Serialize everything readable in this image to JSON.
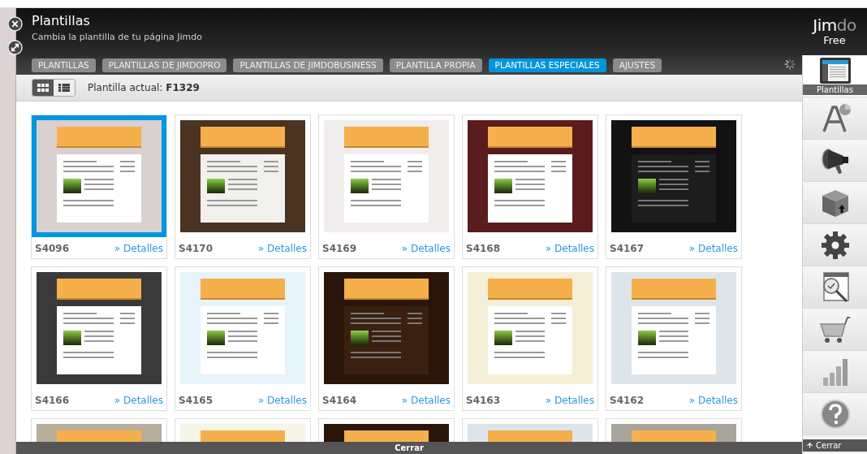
{
  "header": {
    "title": "Plantillas",
    "subtitle": "Cambia la plantilla de tu página Jimdo",
    "logo_parts": [
      "Jim",
      "do"
    ],
    "plan": "Free"
  },
  "tabs": [
    {
      "label": "PLANTILLAS",
      "selected": false
    },
    {
      "label": "PLANTILLAS DE JIMDOPRO",
      "selected": false
    },
    {
      "label": "PLANTILLAS DE JIMDOBUSINESS",
      "selected": false
    },
    {
      "label": "PLANTILLA PROPIA",
      "selected": false
    },
    {
      "label": "PLANTILLAS ESPECIALES",
      "selected": true
    },
    {
      "label": "AJUSTES",
      "selected": false
    }
  ],
  "toolbar": {
    "views": [
      {
        "kind": "grid",
        "selected": true
      },
      {
        "kind": "list",
        "selected": false
      }
    ],
    "current_label": "Plantilla actual:",
    "current_value": "F1329"
  },
  "templates": [
    {
      "code": "S4096",
      "link": "» Detalles",
      "kind": "lilac",
      "selected": true
    },
    {
      "code": "S4170",
      "link": "» Detalles",
      "kind": "wood",
      "selected": false
    },
    {
      "code": "S4169",
      "link": "» Detalles",
      "kind": "pink",
      "selected": false
    },
    {
      "code": "S4168",
      "link": "» Detalles",
      "kind": "maroon",
      "selected": false
    },
    {
      "code": "S4167",
      "link": "» Detalles",
      "kind": "dark",
      "selected": false
    },
    {
      "code": "S4166",
      "link": "» Detalles",
      "kind": "japanese",
      "selected": false
    },
    {
      "code": "S4165",
      "link": "» Detalles",
      "kind": "sky",
      "selected": false
    },
    {
      "code": "S4164",
      "link": "» Detalles",
      "kind": "chocolate",
      "selected": false
    },
    {
      "code": "S4163",
      "link": "» Detalles",
      "kind": "yellow",
      "selected": false
    },
    {
      "code": "S4162",
      "link": "» Detalles",
      "kind": "slate",
      "selected": false
    },
    {
      "kind": "stone",
      "selected": false
    },
    {
      "kind": "cream",
      "selected": false
    },
    {
      "kind": "chocolate",
      "selected": false
    },
    {
      "kind": "slate",
      "selected": false
    },
    {
      "kind": "gray",
      "selected": false
    }
  ],
  "sidebar": [
    {
      "kind": "templates",
      "label": "Plantillas",
      "selected": true
    },
    {
      "kind": "font",
      "selected": false
    },
    {
      "kind": "megaphone",
      "selected": false
    },
    {
      "kind": "box",
      "selected": false
    },
    {
      "kind": "gear",
      "selected": false
    },
    {
      "kind": "inspect",
      "selected": false
    },
    {
      "kind": "cart",
      "selected": false
    },
    {
      "kind": "stats",
      "selected": false
    },
    {
      "kind": "help",
      "selected": false
    }
  ],
  "sidebar_close": "Cerrar",
  "bottom_bar": "Cerrar"
}
